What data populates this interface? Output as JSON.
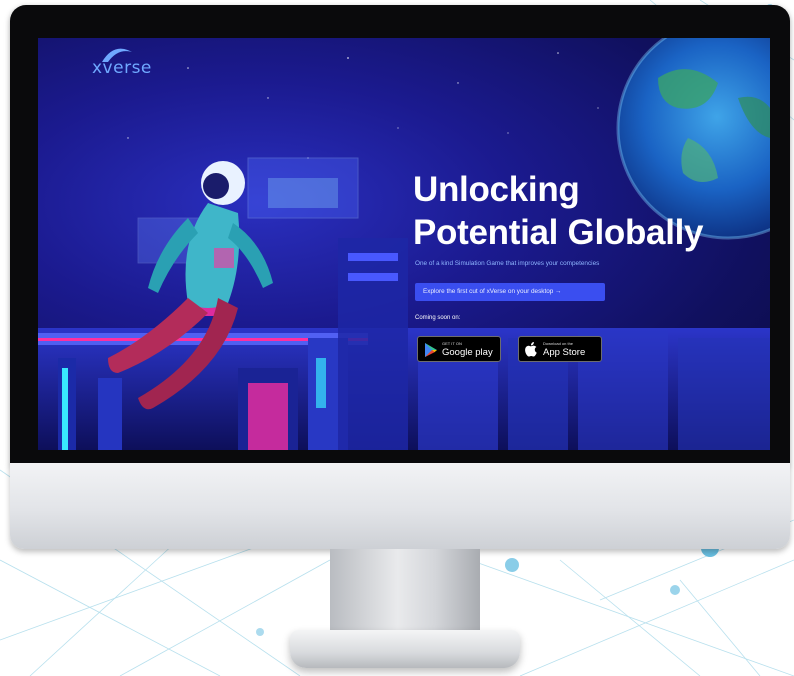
{
  "logo": {
    "text": "xverse",
    "tagline": "",
    "icon": "swoosh-logo-icon"
  },
  "hero": {
    "title_line1": "Unlocking",
    "title_line2": "Potential Globally",
    "subtitle": "One of a kind Simulation Game that improves your competencies",
    "cta_label": "Explore the first cut of xVerse on your desktop →"
  },
  "availability": {
    "coming_soon": "Coming soon on:",
    "google_play": {
      "small": "GET IT ON",
      "big": "Google play",
      "icon": "play-store-icon"
    },
    "app_store": {
      "small": "Download on the",
      "big": "App Store",
      "icon": "apple-icon"
    }
  },
  "colors": {
    "screen_bg": "#1b1a8f",
    "cta_bg": "#3a4ef0",
    "title": "#ffffff",
    "accent_text": "#8fb6ff",
    "neon_pink": "#ff2fa0",
    "neon_cyan": "#38e8ff"
  },
  "illustration": {
    "subject": "astronaut-floating-illustration",
    "planet": "earth-planet-illustration"
  }
}
